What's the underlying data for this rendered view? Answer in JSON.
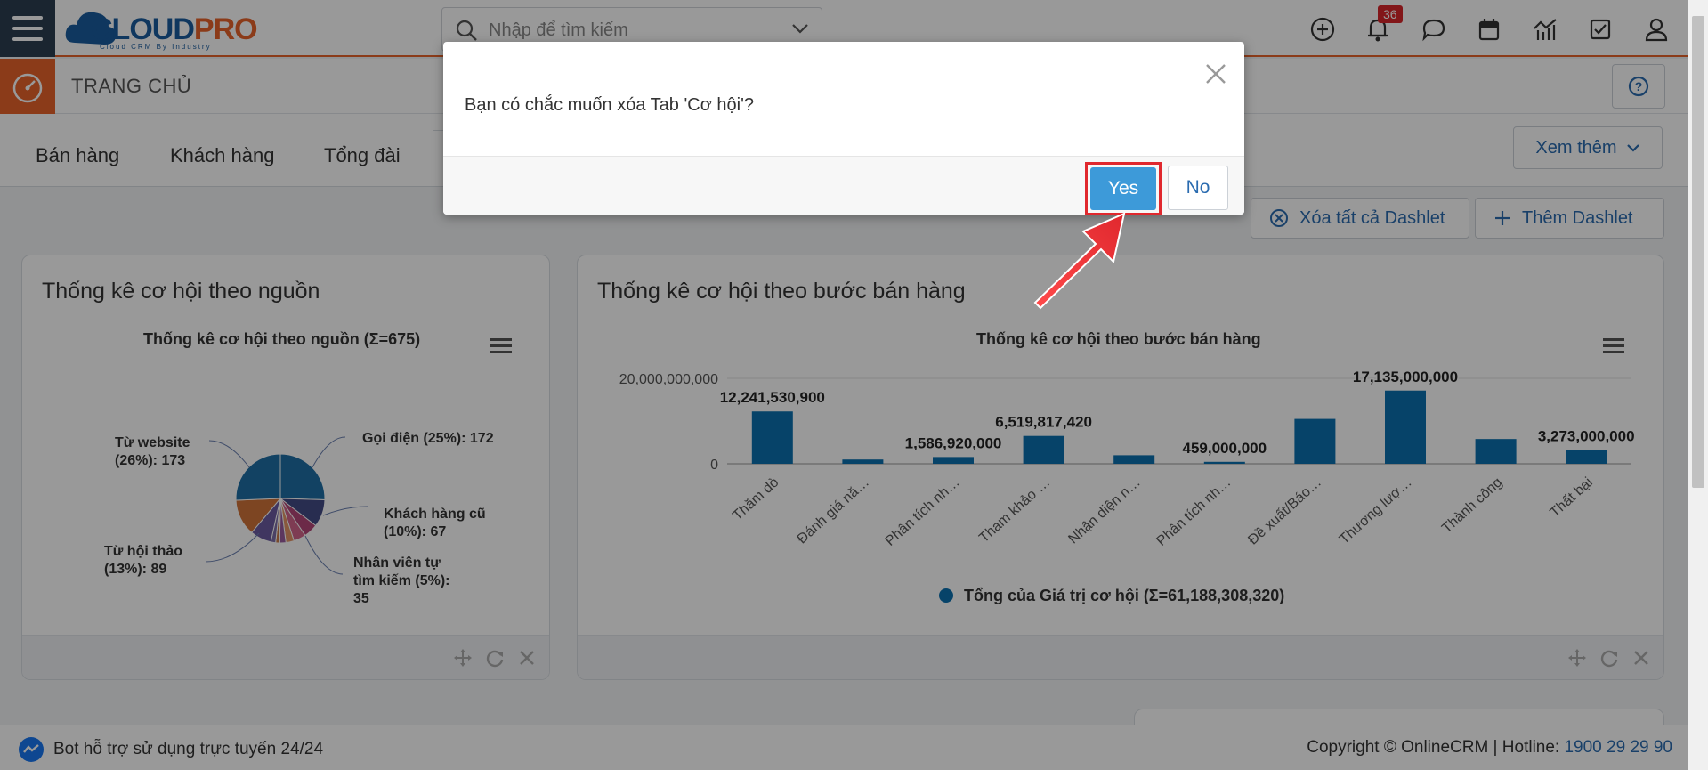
{
  "header": {
    "logo_main": "CLOUD",
    "logo_accent": "PRO",
    "logo_sub": "Cloud CRM By Industry",
    "search_placeholder": "Nhập để tìm kiếm",
    "notification_count": "36"
  },
  "page": {
    "title": "TRANG CHỦ"
  },
  "tabs": [
    {
      "label": "Bán hàng"
    },
    {
      "label": "Khách hàng"
    },
    {
      "label": "Tổng đài"
    }
  ],
  "more_button": "Xem thêm",
  "actions": {
    "clear_all": "Xóa tất cả Dashlet",
    "add": "Thêm Dashlet"
  },
  "dashlet_source": {
    "title": "Thống kê cơ hội theo nguồn",
    "chart_title": "Thống kê cơ hội theo nguồn (Σ=675)"
  },
  "dashlet_stage": {
    "title": "Thống kê cơ hội theo bước bán hàng",
    "chart_title": "Thống kê cơ hội theo bước bán hàng"
  },
  "chart_data": [
    {
      "type": "pie",
      "title": "Thống kê cơ hội theo nguồn (Σ=675)",
      "slices": [
        {
          "name": "Gọi điện",
          "percent": "25%",
          "value": 172,
          "color": "#1f6fa6"
        },
        {
          "name": "Khách hàng cũ",
          "percent": "10%",
          "value": 67,
          "color": "#434c86"
        },
        {
          "name": "Nhân viên tự tìm kiếm",
          "percent": "5%",
          "value": 35,
          "color": "#b44678"
        },
        {
          "name": "",
          "percent": "",
          "value": 30,
          "color": "#d3648a"
        },
        {
          "name": "",
          "percent": "",
          "value": 20,
          "color": "#e49568"
        },
        {
          "name": "",
          "percent": "",
          "value": 15,
          "color": "#9a5c9e"
        },
        {
          "name": "",
          "percent": "",
          "value": 10,
          "color": "#c97a4a"
        },
        {
          "name": "",
          "percent": "",
          "value": 12,
          "color": "#7e6fa8"
        },
        {
          "name": "",
          "percent": "",
          "value": 52,
          "color": "#6b5aa0"
        },
        {
          "name": "Từ hội thảo",
          "percent": "13%",
          "value": 89,
          "color": "#d0733a"
        },
        {
          "name": "Từ website",
          "percent": "26%",
          "value": 173,
          "color": "#1f6fa6"
        }
      ],
      "labels": [
        {
          "line1": "Gọi điện (25%): 172",
          "line2": "",
          "line3": ""
        },
        {
          "line1": "Khách hàng cũ",
          "line2": "(10%): 67",
          "line3": ""
        },
        {
          "line1": "Nhân viên tự",
          "line2": "tìm kiếm (5%):",
          "line3": "35"
        },
        {
          "line1": "Từ hội thảo",
          "line2": "(13%): 89",
          "line3": ""
        },
        {
          "line1": "Từ website",
          "line2": "(26%): 173",
          "line3": ""
        }
      ]
    },
    {
      "type": "bar",
      "title": "Thống kê cơ hội theo bước bán hàng",
      "categories": [
        "Thăm dò",
        "Đánh giá nă…",
        "Phân tích nh…",
        "Tham khảo …",
        "Nhận diện n…",
        "Phân tích nh…",
        "Đề xuất/Báo…",
        "Thương lượ…",
        "Thành công",
        "Thất bại"
      ],
      "series": [
        {
          "name": "Tổng của Giá trị cơ hội (Σ=61,188,308,320)",
          "values": [
            12241530900,
            1000000000,
            1586920000,
            6519817420,
            2000000000,
            459000000,
            10500000000,
            17135000000,
            5800000000,
            3273000000
          ],
          "labels": [
            "12,241,530,900",
            "",
            "1,586,920,000",
            "6,519,817,420",
            "",
            "459,000,000",
            "",
            "17,135,000,000",
            "",
            "3,273,000,000"
          ],
          "color": "#0a71b0"
        }
      ],
      "y_ticks": [
        "20,000,000,000",
        "0"
      ],
      "ylim": [
        0,
        20000000000
      ]
    }
  ],
  "footer": {
    "bot_text": "Bot hỗ trợ sử dụng trực tuyến 24/24",
    "copyright": "Copyright © OnlineCRM | Hotline: ",
    "hotline": "1900 29 29 90"
  },
  "dialog": {
    "message": "Bạn có chắc muốn xóa Tab 'Cơ hội'?",
    "yes_label": "Yes",
    "no_label": "No"
  },
  "colors": {
    "accent": "#e8632b",
    "primary_blue": "#2b6cb0",
    "highlight": "#e0282e"
  }
}
